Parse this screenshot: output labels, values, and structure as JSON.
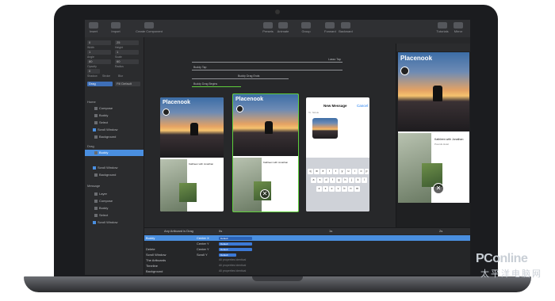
{
  "toolbar": {
    "insert": "Insert",
    "import": "Import",
    "create_component": "Create Component",
    "presets": "Presets",
    "animate": "Animate",
    "group": "Group",
    "forward": "Forward",
    "backward": "Backward",
    "tutorials": "Tutorials",
    "mirror": "Mirror"
  },
  "left_panel": {
    "inputs": [
      "0",
      "25",
      "1",
      "1",
      "80",
      "60",
      "0"
    ],
    "labels": [
      "Width",
      "Height",
      "Angle",
      "Scale",
      "Opacity",
      "Radius",
      "Shadow",
      "Stroke",
      "Blur"
    ],
    "dropdown_1": "Drag",
    "dropdown_2": "Fill Default",
    "tree_sections": [
      "Home",
      "Drag",
      "Message"
    ],
    "tree_items": [
      "Compose",
      "Buddy",
      "Select",
      "Scroll Window",
      "Background",
      "Buddy",
      "Scroll Window",
      "Background",
      "Layer",
      "Compose",
      "Buddy",
      "Select",
      "Scroll Window"
    ]
  },
  "canvas": {
    "flow_labels": [
      "Lasso Tap",
      "Buddy Tap",
      "Buddy Drag Ends",
      "Buddy Drag Begins"
    ],
    "card_title": "Placenook",
    "message_title": "New Message",
    "message_cancel": "Cancel",
    "message_to": "To: Nicole",
    "person_name": "Kathleen with Jonathan",
    "person_sub": "Pounds Hotel",
    "keyboard_row1": [
      "q",
      "w",
      "e",
      "r",
      "t",
      "y",
      "u",
      "i",
      "o",
      "p"
    ],
    "keyboard_row2": [
      "a",
      "s",
      "d",
      "f",
      "g",
      "h",
      "j",
      "k",
      "l"
    ],
    "keyboard_row3": [
      "z",
      "x",
      "c",
      "v",
      "b",
      "n",
      "m"
    ],
    "close_glyph": "✕"
  },
  "timeline": {
    "header": "Any Artboard is Drag",
    "ticks": [
      "0s",
      "1s",
      "2s"
    ],
    "rows": [
      {
        "name": "Buddy",
        "prop": "Center X",
        "val": "Default"
      },
      {
        "name": "",
        "prop": "Center Y",
        "val": "Default"
      },
      {
        "name": "Delete",
        "prop": "Center Y",
        "val": "Default"
      },
      {
        "name": "Scroll Window",
        "prop": "Scroll Y",
        "val": "Default"
      },
      {
        "name": "The Artboards",
        "prop": "All properties identical",
        "val": ""
      },
      {
        "name": "Timeline",
        "prop": "All properties identical",
        "val": ""
      },
      {
        "name": "Background",
        "prop": "All properties identical",
        "val": ""
      }
    ]
  },
  "watermark": {
    "main": "PConline",
    "sub": "太平洋电脑网"
  }
}
